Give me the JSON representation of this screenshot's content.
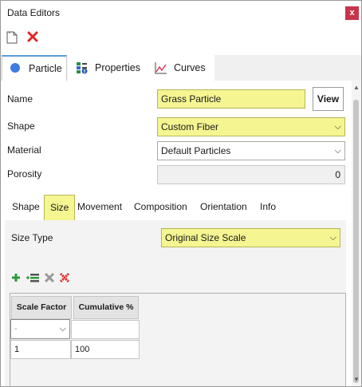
{
  "window": {
    "title": "Data Editors",
    "close_glyph": "x"
  },
  "toolbar": {
    "icons": [
      "new-document-icon",
      "delete-icon"
    ]
  },
  "main_tabs": [
    {
      "label": "Particle",
      "icon": "particle-circle-icon",
      "active": true
    },
    {
      "label": "Properties",
      "icon": "properties-grid-icon",
      "active": false
    },
    {
      "label": "Curves",
      "icon": "curves-chart-icon",
      "active": false
    }
  ],
  "form": {
    "name_label": "Name",
    "name_value": "Grass Particle",
    "view_label": "View",
    "shape_label": "Shape",
    "shape_value": "Custom Fiber",
    "material_label": "Material",
    "material_value": "Default Particles",
    "porosity_label": "Porosity",
    "porosity_value": "0"
  },
  "sub_tabs": [
    {
      "label": "Shape",
      "active": false
    },
    {
      "label": "Size",
      "active": true
    },
    {
      "label": "Movement",
      "active": false
    },
    {
      "label": "Composition",
      "active": false
    },
    {
      "label": "Orientation",
      "active": false
    },
    {
      "label": "Info",
      "active": false
    }
  ],
  "size_panel": {
    "size_type_label": "Size Type",
    "size_type_value": "Original Size Scale",
    "grid_icons": [
      "add-row-icon",
      "insert-row-icon",
      "remove-row-icon",
      "clear-all-icon"
    ],
    "columns": [
      "Scale Factor",
      "Cumulative %"
    ],
    "dropdown_placeholder": "-",
    "rows": [
      [
        "1",
        "100"
      ]
    ]
  },
  "colors": {
    "highlight_yellow": "#f5f592",
    "close_red": "#c8344a",
    "tab_accent": "#5b9bd5"
  }
}
